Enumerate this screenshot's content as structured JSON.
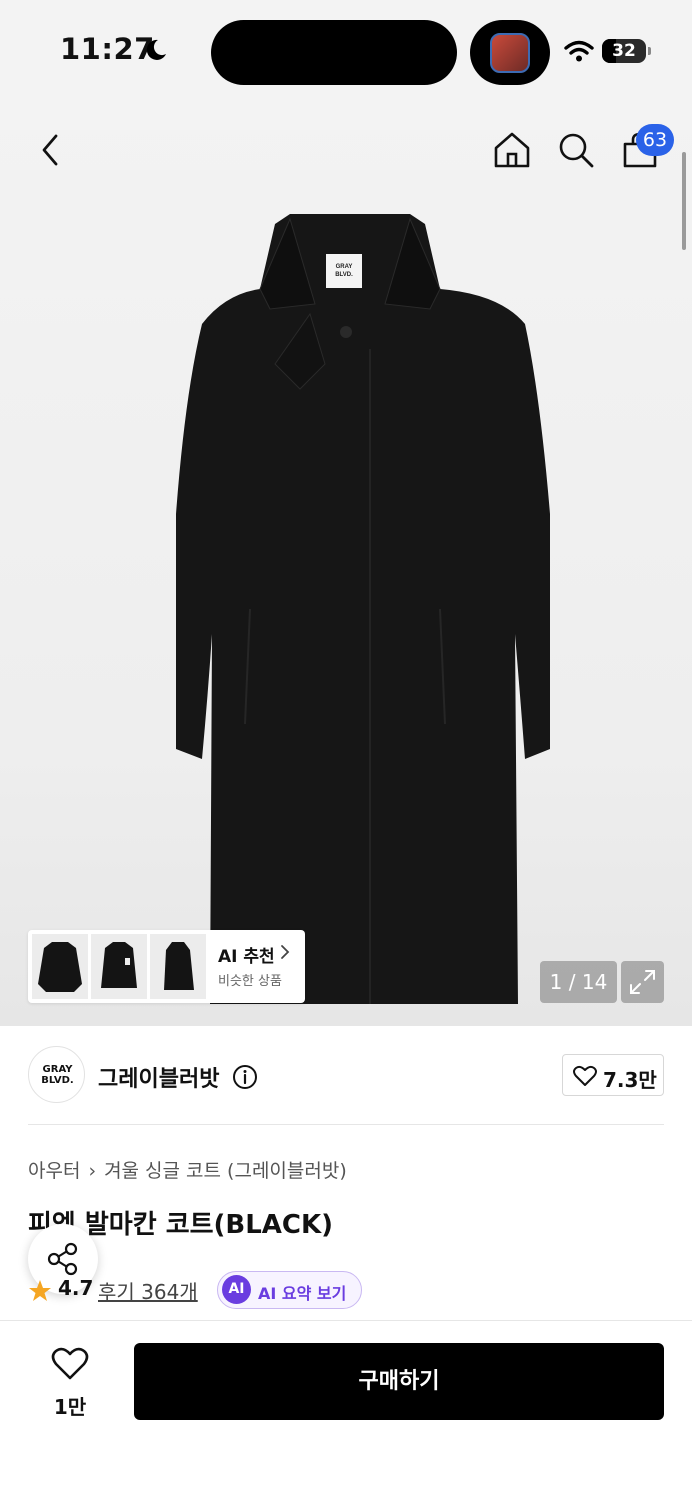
{
  "status_bar": {
    "time": "11:27",
    "battery": "32"
  },
  "header": {
    "cart_count": "63"
  },
  "similar_products": {
    "title": "AI 추천",
    "subtitle": "비슷한 상품"
  },
  "gallery": {
    "counter": "1 / 14"
  },
  "brand": {
    "logo_text_line1": "GRAY",
    "logo_text_line2": "BLVD.",
    "name": "그레이블러밧",
    "likes": "7.3만"
  },
  "product": {
    "breadcrumb": [
      "아우터",
      "겨울 싱글 코트 (그레이블러밧)"
    ],
    "title": "피엠 발마칸 코트(BLACK)",
    "rating": "4.7",
    "reviews": "후기 364개",
    "ai_summary": {
      "badge": "AI",
      "label": "AI 요약 보기"
    }
  },
  "bottom_bar": {
    "wish_count": "1만",
    "buy_label": "구매하기"
  },
  "colors": {
    "cart_badge": "#2a62e8",
    "ai_accent": "#6a3de0",
    "star": "#f5a623",
    "buy_button": "#000000"
  }
}
